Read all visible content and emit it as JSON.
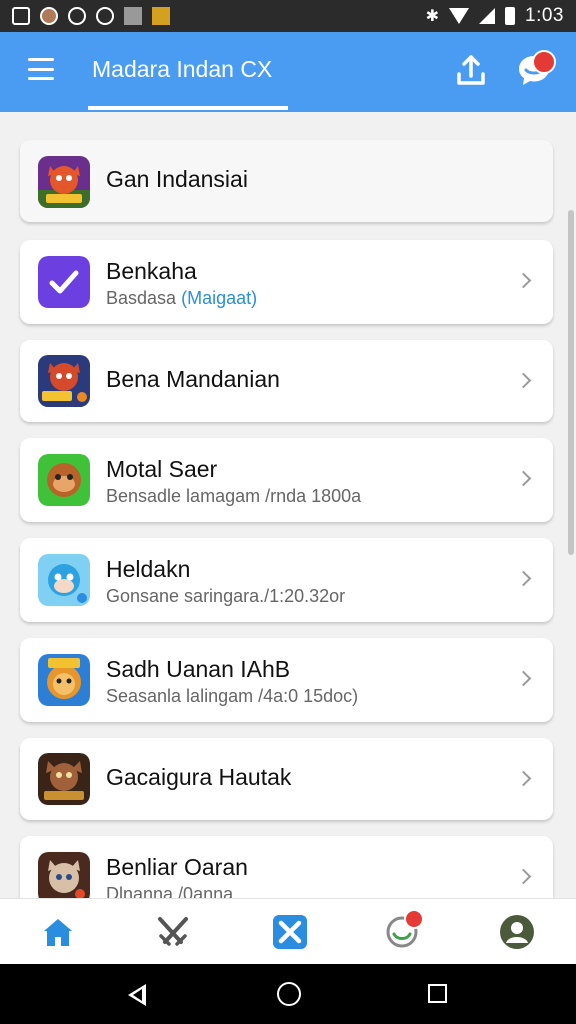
{
  "status_bar": {
    "time": "1:03"
  },
  "app_bar": {
    "title": "Madara Indan CX",
    "chat_badge": ""
  },
  "items": [
    {
      "title": "Gan Indansiai",
      "subtitle": "",
      "subtitle_link": "",
      "icon": "fox-game-icon"
    },
    {
      "title": "Benkaha",
      "subtitle": "Basdasa",
      "subtitle_link": "(Maigaat)",
      "icon": "check-box-icon"
    },
    {
      "title": "Bena Mandanian",
      "subtitle": "",
      "subtitle_link": "",
      "icon": "red-panda-game-icon"
    },
    {
      "title": "Motal Saer",
      "subtitle": "Bensadle lamagam /rnda 1800a",
      "subtitle_link": "",
      "icon": "monkey-game-icon"
    },
    {
      "title": "Heldakn",
      "subtitle": "Gonsane saringara./1:20.32or",
      "subtitle_link": "",
      "icon": "blue-character-icon"
    },
    {
      "title": "Sadh Uanan IAhB",
      "subtitle": "Seasanla lalingam /4a:0 15doc)",
      "subtitle_link": "",
      "icon": "lion-game-icon"
    },
    {
      "title": "Gacaigura Hautak",
      "subtitle": "",
      "subtitle_link": "",
      "icon": "warrior-game-icon"
    },
    {
      "title": "Benliar Oaran",
      "subtitle": "Dlnanna /0anna",
      "subtitle_link": "",
      "icon": "cat-game-icon"
    }
  ],
  "bottom_nav": [
    {
      "name": "home-icon"
    },
    {
      "name": "swords-icon"
    },
    {
      "name": "tools-icon"
    },
    {
      "name": "messages-icon"
    },
    {
      "name": "profile-icon"
    }
  ],
  "colors": {
    "app_bar": "#4a9cf2",
    "accent": "#2b8de0",
    "badge": "#e53935"
  }
}
